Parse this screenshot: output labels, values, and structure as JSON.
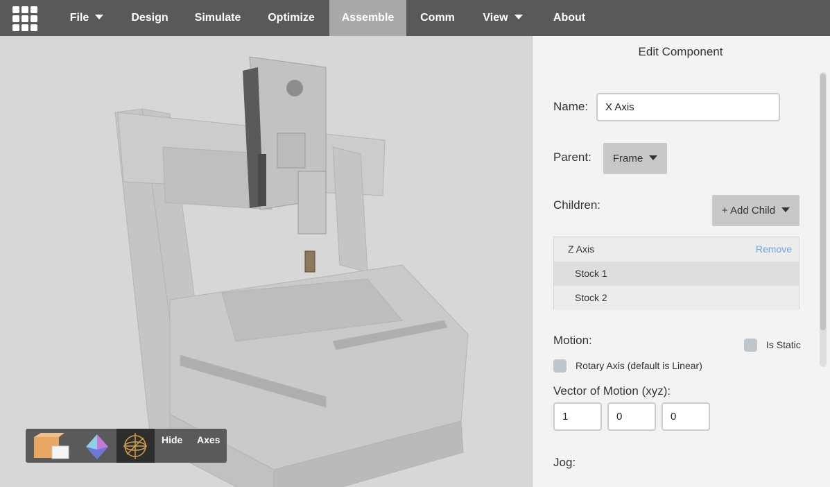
{
  "nav": {
    "items": [
      {
        "label": "File",
        "dropdown": true
      },
      {
        "label": "Design"
      },
      {
        "label": "Simulate"
      },
      {
        "label": "Optimize"
      },
      {
        "label": "Assemble",
        "active": true
      },
      {
        "label": "Comm"
      },
      {
        "label": "View",
        "dropdown": true
      },
      {
        "label": "About"
      }
    ]
  },
  "viewport": {
    "toolbar": {
      "icons": [
        "box-icon",
        "octahedron-icon",
        "axes-gimbal-icon"
      ],
      "hide_label": "Hide",
      "axes_label": "Axes"
    }
  },
  "panel": {
    "title": "Edit Component",
    "name_label": "Name:",
    "name_value": "X Axis",
    "parent_label": "Parent:",
    "parent_value": "Frame",
    "children_label": "Children:",
    "add_child_label": "+ Add Child",
    "children": [
      {
        "label": "Z Axis",
        "action": "Remove"
      },
      {
        "label": "Stock 1"
      },
      {
        "label": "Stock 2"
      }
    ],
    "motion_label": "Motion:",
    "is_static_label": "Is Static",
    "rotary_label": "Rotary Axis (default is Linear)",
    "vector_label": "Vector of Motion (xyz):",
    "vector": [
      "1",
      "0",
      "0"
    ],
    "jog_label": "Jog:"
  },
  "colors": {
    "topbar": "#595959",
    "active_tab": "#a9a9a9",
    "remove_link": "#6fa6e0"
  }
}
